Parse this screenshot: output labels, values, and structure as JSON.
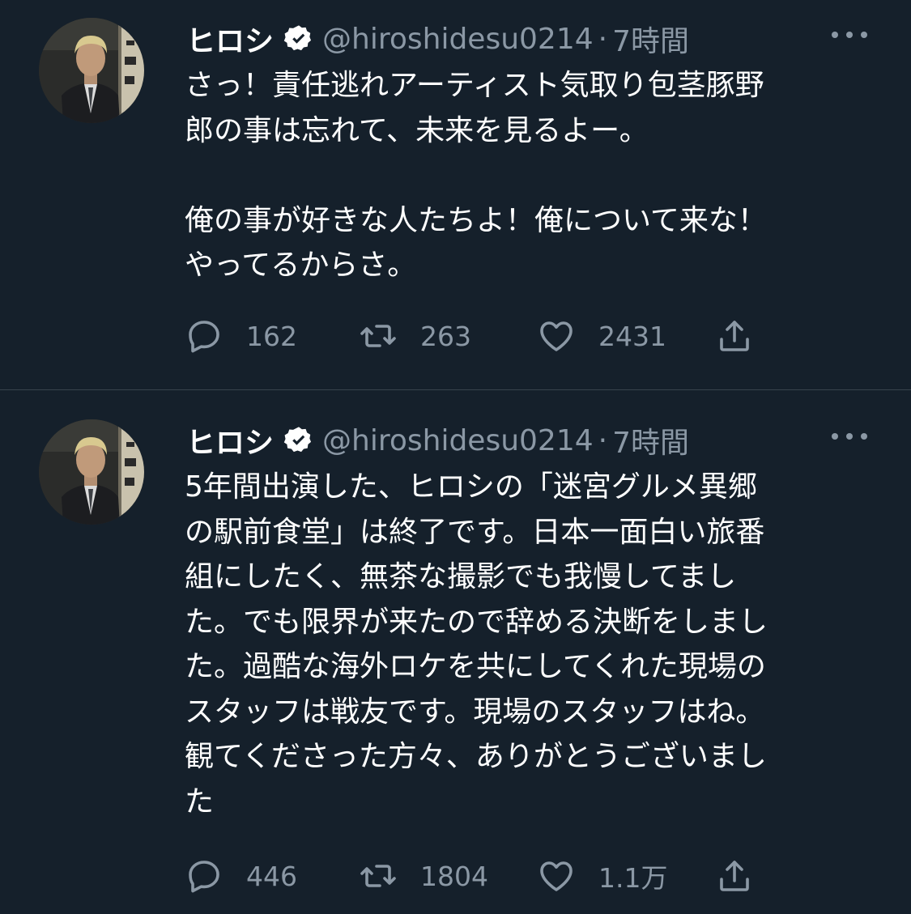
{
  "colors": {
    "background": "#15202b",
    "text": "#ffffff",
    "muted": "#8b98a5",
    "divider": "#38444d"
  },
  "tweets": [
    {
      "name": "ヒロシ",
      "handle": "@hiroshidesu0214",
      "separator": "·",
      "time": "7時間",
      "verified_icon": "verified-badge-icon",
      "lines": [
        "さっ！責任逃れアーティスト気取り包茎豚野",
        "郎の事は忘れて、未来を見るよー。",
        "",
        "俺の事が好きな人たちよ！俺について来な！",
        "やってるからさ。"
      ],
      "replies": "162",
      "retweets": "263",
      "likes": "2431"
    },
    {
      "name": "ヒロシ",
      "handle": "@hiroshidesu0214",
      "separator": "·",
      "time": "7時間",
      "verified_icon": "verified-badge-icon",
      "lines": [
        "5年間出演した、ヒロシの「迷宮グルメ異郷",
        "の駅前食堂」は終了です。日本一面白い旅番",
        "組にしたく、無茶な撮影でも我慢してまし",
        "た。でも限界が来たので辞める決断をしまし",
        "た。過酷な海外ロケを共にしてくれた現場の",
        "スタッフは戦友です。現場のスタッフはね。",
        "観てくださった方々、ありがとうございまし",
        "た"
      ],
      "replies": "446",
      "retweets": "1804",
      "likes": "1.1万"
    }
  ]
}
